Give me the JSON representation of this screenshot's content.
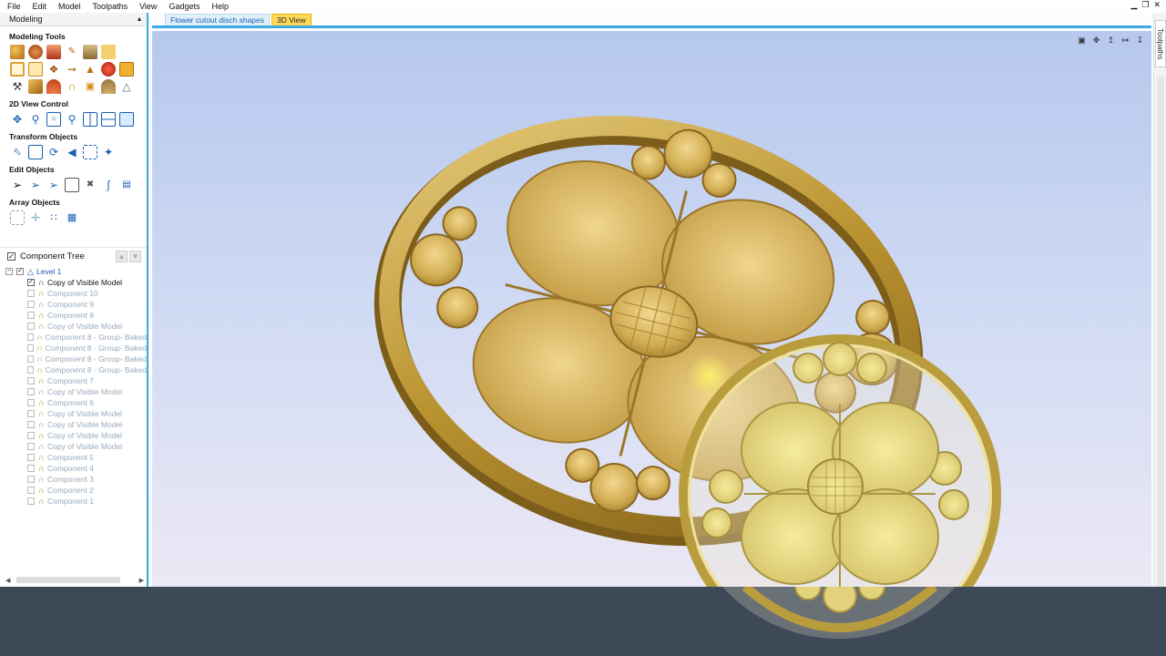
{
  "menu": [
    "File",
    "Edit",
    "Model",
    "Toolpaths",
    "View",
    "Gadgets",
    "Help"
  ],
  "window_controls": [
    "▁",
    "❐",
    "✕"
  ],
  "panel": {
    "title": "Modeling",
    "sections": {
      "modeling_tools": "Modeling Tools",
      "view_control": "2D View Control",
      "transform": "Transform Objects",
      "edit": "Edit Objects",
      "array": "Array Objects"
    }
  },
  "component_tree": {
    "title": "Component Tree",
    "level": "Level 1",
    "items": [
      {
        "label": "Copy of Visible Model",
        "checked": true
      },
      {
        "label": "Component 10"
      },
      {
        "label": "Component 9"
      },
      {
        "label": "Component 8"
      },
      {
        "label": "Copy of Visible Model"
      },
      {
        "label": "Component 8 - Group- Baked"
      },
      {
        "label": "Component 8 - Group- Baked"
      },
      {
        "label": "Component 8 - Group- Baked"
      },
      {
        "label": "Component 8 - Group- Baked"
      },
      {
        "label": "Component 7"
      },
      {
        "label": "Copy of Visible Model"
      },
      {
        "label": "Component 6"
      },
      {
        "label": "Copy of Visible Model"
      },
      {
        "label": "Copy of Visible Model"
      },
      {
        "label": "Copy of Visible Model"
      },
      {
        "label": "Copy of Visible Model"
      },
      {
        "label": "Component 5"
      },
      {
        "label": "Component 4"
      },
      {
        "label": "Component 3"
      },
      {
        "label": "Component 2"
      },
      {
        "label": "Component 1"
      }
    ]
  },
  "tabs": [
    "Flower cutout disch shapes",
    "3D View"
  ],
  "active_tab": "3D View",
  "right_tab": "Toolpaths",
  "colors": {
    "accent": "#39a9e0",
    "gold": "#c9a94a",
    "bottom_bar": "#3e4957"
  }
}
